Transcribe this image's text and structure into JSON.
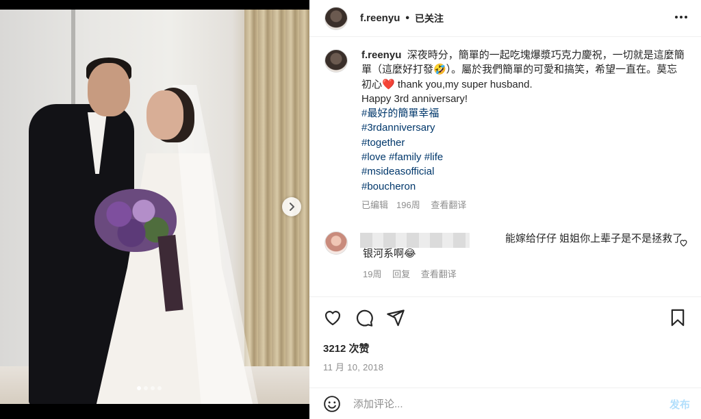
{
  "post": {
    "username": "f.reenyu",
    "separator": "•",
    "follow_status": "已关注",
    "more_icon": "more-horizontal-icon",
    "carousel_dots_count": 4,
    "carousel_active_index": 0
  },
  "caption": {
    "username": "f.reenyu",
    "text_line1": "深夜時分，簡單的一起吃塊爆漿巧克力慶祝，一切就是這麼簡單（這麼好打發🤣）。屬於我們簡單的可愛和搞笑，希望一直在。莫忘初心❤️ thank you,my super husband.",
    "text_line2": "Happy 3rd anniversary!",
    "hashtags": [
      "#最好的簡單幸福",
      "#3rdanniversary",
      "#together",
      "#love #family #life",
      "#msideasofficial",
      "#boucheron"
    ],
    "edited": "已编辑",
    "age": "196周",
    "translate": "查看翻译"
  },
  "comment": {
    "text": "能嫁给仔仔 姐姐你上辈子是不是拯救了银河系啊😂",
    "age": "19周",
    "reply": "回复",
    "translate": "查看翻译"
  },
  "stats": {
    "likes": "3212 次赞",
    "date": "11 月 10, 2018"
  },
  "composer": {
    "placeholder": "添加评论...",
    "post_label": "发布"
  },
  "colors": {
    "hashtag": "#00376b",
    "secondary_text": "#8e8e8e",
    "post_disabled": "#b2dffc",
    "divider": "#efefef"
  }
}
